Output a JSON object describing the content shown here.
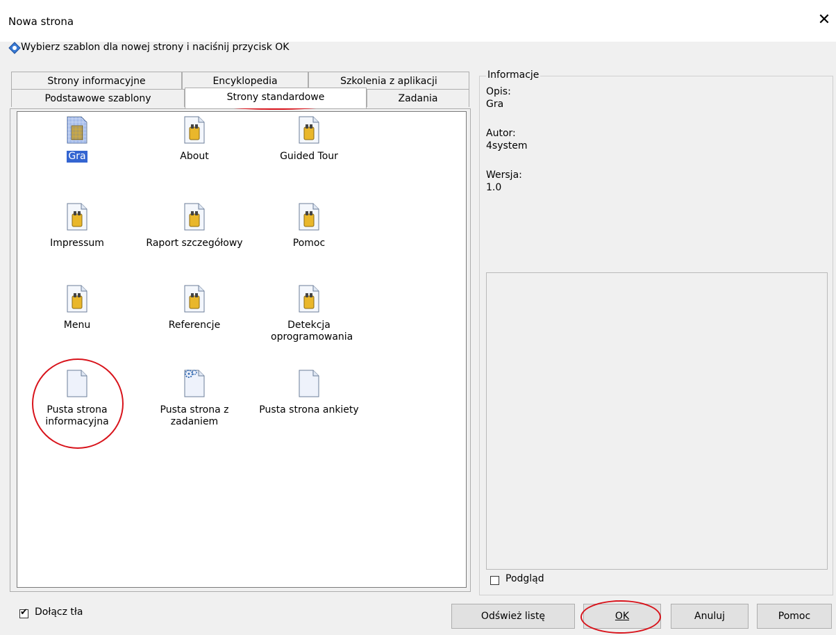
{
  "window": {
    "title": "Nowa strona",
    "close_label": "✕"
  },
  "instruction": "Wybierz szablon dla nowej strony i naciśnij przycisk OK",
  "tabs": {
    "row1": [
      "Strony informacyjne",
      "Encyklopedia",
      "Szkolenia z aplikacji"
    ],
    "row2": [
      "Podstawowe szablony",
      "Strony standardowe",
      "Zadania"
    ],
    "active": "Strony standardowe"
  },
  "templates": [
    {
      "label": "Gra",
      "selected": true
    },
    {
      "label": "About"
    },
    {
      "label": "Guided Tour"
    },
    {
      "label": "Impressum"
    },
    {
      "label": "Raport szczegółowy"
    },
    {
      "label": "Pomoc"
    },
    {
      "label": "Menu"
    },
    {
      "label": "Referencje"
    },
    {
      "label": "Detekcja oprogramowania"
    },
    {
      "label": "Pusta strona informacyjna"
    },
    {
      "label": "Pusta strona z zadaniem"
    },
    {
      "label": "Pusta strona ankiety"
    }
  ],
  "info": {
    "legend": "Informacje",
    "desc_label": "Opis:",
    "desc_value": "Gra",
    "author_label": "Autor:",
    "author_value": "4system",
    "version_label": "Wersja:",
    "version_value": "1.0",
    "preview_label": "Podgląd",
    "preview_checked": false
  },
  "attach_bg": {
    "label": "Dołącz tła",
    "checked": true
  },
  "buttons": {
    "refresh": "Odśwież listę",
    "ok": "OK",
    "cancel": "Anuluj",
    "help": "Pomoc"
  },
  "colors": {
    "selection": "#3465d1",
    "annotation": "#d8131b"
  }
}
